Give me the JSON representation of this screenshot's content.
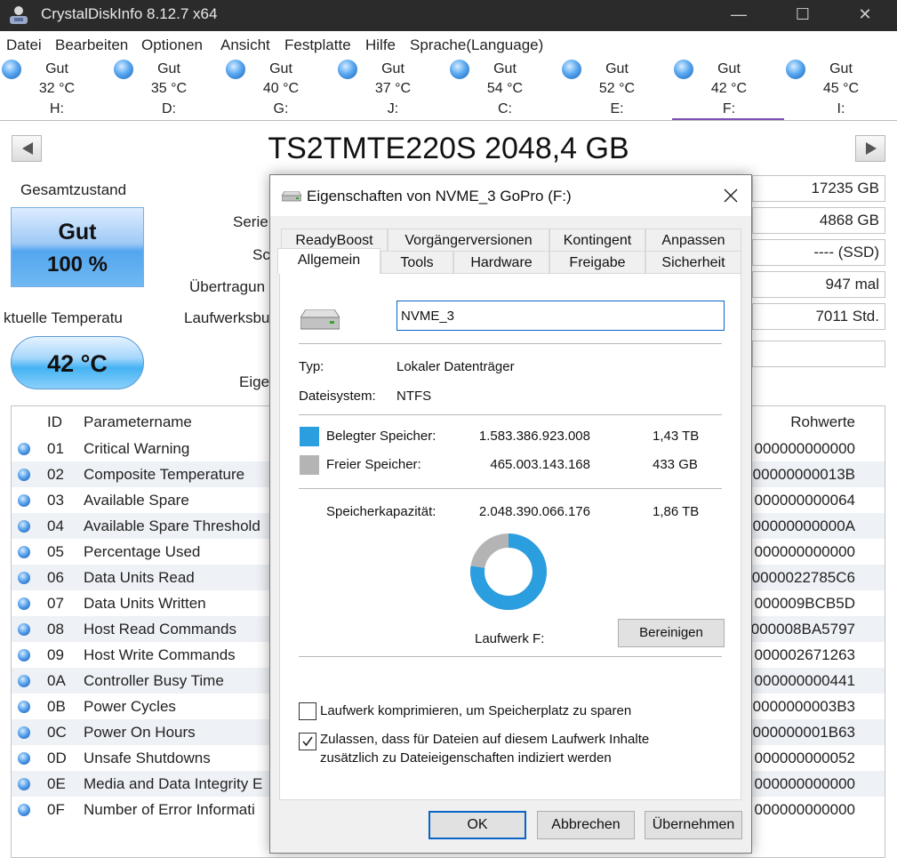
{
  "window": {
    "title": "CrystalDiskInfo 8.12.7 x64",
    "minimize": "—",
    "maximize": "☐",
    "close": "✕"
  },
  "menu": [
    "Datei",
    "Bearbeiten",
    "Optionen",
    "Ansicht",
    "Festplatte",
    "Hilfe",
    "Sprache(Language)"
  ],
  "drives": [
    {
      "status": "Gut",
      "temp": "32 °C",
      "letter": "H:"
    },
    {
      "status": "Gut",
      "temp": "35 °C",
      "letter": "D:"
    },
    {
      "status": "Gut",
      "temp": "40 °C",
      "letter": "G:"
    },
    {
      "status": "Gut",
      "temp": "37 °C",
      "letter": "J:"
    },
    {
      "status": "Gut",
      "temp": "54 °C",
      "letter": "C:"
    },
    {
      "status": "Gut",
      "temp": "52 °C",
      "letter": "E:"
    },
    {
      "status": "Gut",
      "temp": "42 °C",
      "letter": "F:"
    },
    {
      "status": "Gut",
      "temp": "45 °C",
      "letter": "I:"
    }
  ],
  "selected_drive_letter": "F:",
  "disk": {
    "model": "TS2TMTE220S 2048,4 GB",
    "health_label": "Gesamtzustand",
    "health_status": "Gut",
    "health_percent": "100 %",
    "temp_label": "ktuelle Temperatu",
    "temp_value": "42 °C"
  },
  "info_labels": [
    "Serie",
    "Sc",
    "Übertragun",
    "Laufwerksbu",
    "Eige"
  ],
  "info_values": [
    "17235 GB",
    "4868 GB",
    "---- (SSD)",
    "947 mal",
    "7011 Std."
  ],
  "smart": {
    "headers": {
      "id": "ID",
      "name": "Parametername",
      "raw": "Rohwerte"
    },
    "rows": [
      {
        "id": "01",
        "name": "Critical Warning",
        "raw": "000000000000"
      },
      {
        "id": "02",
        "name": "Composite Temperature",
        "raw": "00000000013B"
      },
      {
        "id": "03",
        "name": "Available Spare",
        "raw": "000000000064"
      },
      {
        "id": "04",
        "name": "Available Spare Threshold",
        "raw": "00000000000A"
      },
      {
        "id": "05",
        "name": "Percentage Used",
        "raw": "000000000000"
      },
      {
        "id": "06",
        "name": "Data Units Read",
        "raw": "0000022785C6"
      },
      {
        "id": "07",
        "name": "Data Units Written",
        "raw": "000009BCB5D"
      },
      {
        "id": "08",
        "name": "Host Read Commands",
        "raw": "000008BA5797"
      },
      {
        "id": "09",
        "name": "Host Write Commands",
        "raw": "000002671263"
      },
      {
        "id": "0A",
        "name": "Controller Busy Time",
        "raw": "000000000441"
      },
      {
        "id": "0B",
        "name": "Power Cycles",
        "raw": "0000000003B3"
      },
      {
        "id": "0C",
        "name": "Power On Hours",
        "raw": "000000001B63"
      },
      {
        "id": "0D",
        "name": "Unsafe Shutdowns",
        "raw": "000000000052"
      },
      {
        "id": "0E",
        "name": "Media and Data Integrity E",
        "raw": "000000000000"
      },
      {
        "id": "0F",
        "name": "Number of Error Informati",
        "raw": "000000000000"
      }
    ]
  },
  "dialog": {
    "title": "Eigenschaften von NVME_3 GoPro (F:)",
    "tabs_row1": [
      "ReadyBoost",
      "Vorgängerversionen",
      "Kontingent",
      "Anpassen"
    ],
    "tabs_row2": [
      "Allgemein",
      "Tools",
      "Hardware",
      "Freigabe",
      "Sicherheit"
    ],
    "active_tab": "Allgemein",
    "volume_name": "NVME_3",
    "type_label": "Typ:",
    "type_value": "Lokaler Datenträger",
    "fs_label": "Dateisystem:",
    "fs_value": "NTFS",
    "used_label": "Belegter Speicher:",
    "used_bytes": "1.583.386.923.008",
    "used_size": "1,43 TB",
    "free_label": "Freier Speicher:",
    "free_bytes": "465.003.143.168",
    "free_size": "433 GB",
    "capacity_label": "Speicherkapazität:",
    "capacity_bytes": "2.048.390.066.176",
    "capacity_size": "1,86 TB",
    "drive_label": "Laufwerk F:",
    "cleanup_button": "Bereinigen",
    "compress_label": "Laufwerk komprimieren, um Speicherplatz zu sparen",
    "compress_checked": false,
    "index_label_line1": "Zulassen, dass für Dateien auf diesem Laufwerk Inhalte",
    "index_label_line2": "zusätzlich zu Dateieigenschaften indiziert werden",
    "index_checked": true,
    "ok_button": "OK",
    "cancel_button": "Abbrechen",
    "apply_button": "Übernehmen",
    "used_fraction": 0.773,
    "colors": {
      "used": "#2b9ee0",
      "free": "#b4b4b4",
      "accent": "#0a64c8"
    }
  }
}
